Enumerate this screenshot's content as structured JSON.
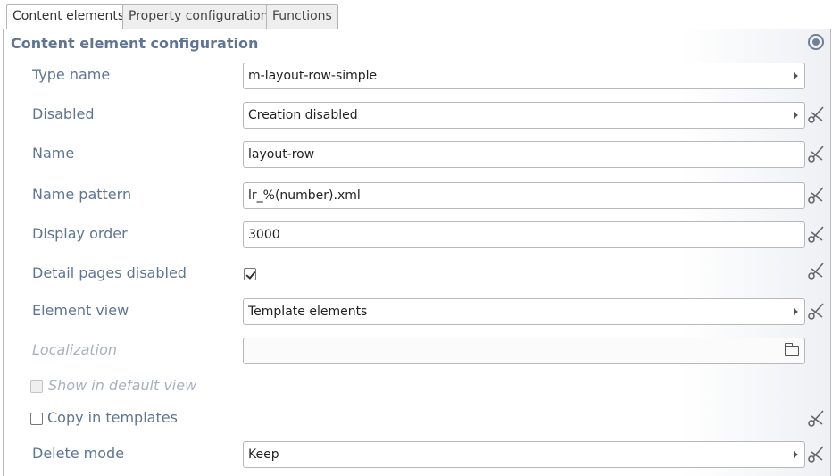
{
  "tabs": [
    {
      "label": "Content elements",
      "active": true
    },
    {
      "label": "Property configuration",
      "active": false
    },
    {
      "label": "Functions",
      "active": false
    }
  ],
  "section": {
    "title": "Content element configuration"
  },
  "fields": {
    "type_name": {
      "label": "Type name",
      "value": "m-layout-row-simple"
    },
    "disabled": {
      "label": "Disabled",
      "value": "Creation disabled"
    },
    "name": {
      "label": "Name",
      "value": "layout-row"
    },
    "name_pattern": {
      "label": "Name pattern",
      "value": "lr_%(number).xml"
    },
    "display_order": {
      "label": "Display order",
      "value": "3000"
    },
    "detail_pages_disabled": {
      "label": "Detail pages disabled",
      "checked": true
    },
    "element_view": {
      "label": "Element view",
      "value": "Template elements"
    },
    "localization": {
      "label": "Localization",
      "value": ""
    },
    "show_in_default_view": {
      "label": "Show in default view",
      "checked": false
    },
    "copy_in_templates": {
      "label": "Copy in templates",
      "checked": false
    },
    "delete_mode": {
      "label": "Delete mode",
      "value": "Keep"
    }
  },
  "icons": {
    "collapse": "collapse-circle-icon",
    "scissors": "scissors-icon",
    "folder": "folder-icon",
    "dropdown": "chevron-right-icon"
  }
}
